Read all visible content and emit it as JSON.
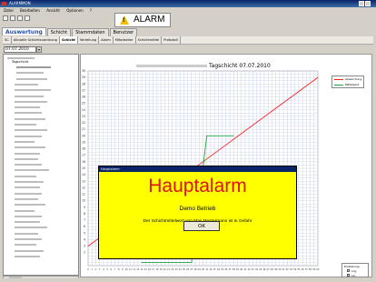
{
  "window": {
    "title": "ALARMMON"
  },
  "menu": [
    "Datei",
    "Bearbeiten",
    "Ansicht",
    "Optionen",
    "?"
  ],
  "alarm_button": {
    "label": "ALARM"
  },
  "main_tabs": [
    "Auswertung",
    "Schicht",
    "Stammdaten",
    "Benutzer"
  ],
  "sub_tabs": [
    "SC",
    "Aktuelle Schichtzuordnung",
    "Schicht",
    "Verteilung",
    "Alarm",
    "Mitarbeiter",
    "Schichtmittel",
    "Protokoll"
  ],
  "date_field": {
    "value": "07.07.2010"
  },
  "tree": {
    "root_label": "Tagschicht"
  },
  "chart": {
    "title_suffix": "Tagschicht  07.07.2010",
    "legend": [
      "Abweichung",
      "Mittelwert"
    ]
  },
  "chart_data": {
    "type": "line",
    "x": [
      0,
      1,
      2,
      3,
      4,
      5,
      6,
      7,
      8,
      9,
      10,
      11,
      12,
      13,
      14,
      15,
      16,
      17,
      18,
      19,
      20,
      21,
      22,
      23,
      24,
      25,
      26,
      27,
      28,
      29,
      30,
      31,
      32,
      33,
      34,
      35,
      36,
      37,
      38,
      39,
      40,
      41,
      42,
      43,
      44,
      45,
      46,
      47,
      48,
      49,
      50,
      51,
      52,
      53,
      54,
      55,
      56,
      57,
      58,
      59,
      60
    ],
    "ylim": [
      0,
      30
    ],
    "yticks": [
      2,
      3,
      4,
      5,
      6,
      7,
      8,
      9,
      10,
      11,
      12,
      13,
      14,
      15,
      16,
      17,
      18,
      19,
      20,
      21,
      22,
      23,
      24,
      25,
      26,
      27,
      28,
      29,
      30
    ],
    "series": [
      {
        "name": "Abweichung",
        "color": "#ff2020",
        "points": [
          [
            0,
            3.0
          ],
          [
            60,
            29.0
          ]
        ]
      },
      {
        "name": "Mittelwert",
        "color": "#20a040",
        "points": [
          [
            14,
            0.5
          ],
          [
            27,
            0.5
          ],
          [
            31,
            20.0
          ],
          [
            38,
            20.0
          ]
        ]
      }
    ]
  },
  "dialog": {
    "title": "Hauptalarm",
    "heading": "Hauptalarm",
    "subheading": "Demo Betrieb",
    "message": "Der Schichtmittelwert von Max Mustermann ist in Gefahr",
    "ok_label": "OK"
  },
  "controls": {
    "title": "Einstellung",
    "options": [
      "Log",
      "Lin"
    ]
  }
}
